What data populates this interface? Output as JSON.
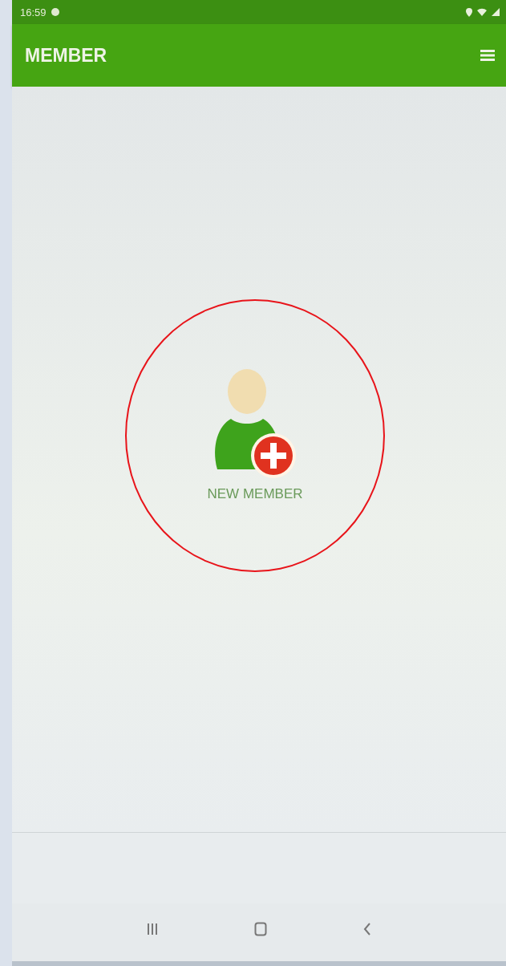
{
  "status_bar": {
    "time": "16:59"
  },
  "app_bar": {
    "title": "MEMBER"
  },
  "new_member_button": {
    "label": "NEW MEMBER",
    "highlighted": true
  }
}
